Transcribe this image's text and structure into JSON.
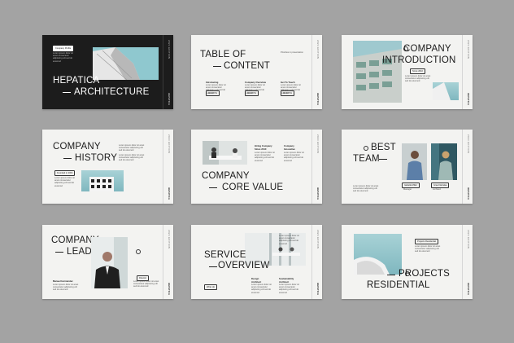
{
  "slides": {
    "s1": {
      "badge": "Company Profile",
      "title1": "HEPATICA",
      "title2": "ARCHITECTURE",
      "side_top": "2023 EDITION",
      "side_bot": "HEPATICA"
    },
    "s2": {
      "title1": "TABLE OF",
      "title2": "CONTENT",
      "c1": "Introducing",
      "c2": "Company Overview",
      "c3": "Get To Touch",
      "c3b": "Priorities in presentation",
      "n1": "00-00 PH",
      "n2": "00-00 PH",
      "n3": "00-00 PH",
      "side_top": "2023 EDITION",
      "side_bot": "HEPATICA"
    },
    "s3": {
      "title1": "COMPANY",
      "title2": "INTRODUCTION",
      "badge": "Since 2010",
      "side_top": "2023 EDITION",
      "side_bot": "HEPATICA"
    },
    "s4": {
      "title1": "COMPANY",
      "title2": "HISTORY",
      "badge": "Founded in 2004",
      "side_top": "2023 EDITION",
      "side_bot": "HEPATICA"
    },
    "s5": {
      "title1": "COMPANY",
      "title2": "CORE VALUE",
      "h1": "Hiring Company Since 2010",
      "h2": "Company Innovative",
      "side_top": "2023 EDITION",
      "side_bot": "HEPATICA"
    },
    "s6": {
      "title1": "BEST",
      "title2": "TEAM",
      "n1": "Isabella Miller",
      "r1": "Manager",
      "n2": "Grea Narralaa",
      "r2": "Architect",
      "side_top": "2023 EDITION",
      "side_bot": "HEPATICA"
    },
    "s7": {
      "title1": "COMPANY",
      "title2": "LEADER",
      "badge": "Director",
      "name": "Manuel Hernandez",
      "side_top": "2023 EDITION",
      "side_bot": "HEPATICA"
    },
    "s8": {
      "title1": "SERVICE",
      "title2": "OVERVIEW",
      "h1": "Design Architect",
      "h2": "Sustainability Architect",
      "btn": "Write Up",
      "side_top": "2023 EDITION",
      "side_bot": "HEPATICA"
    },
    "s9": {
      "title1": "PROJECTS",
      "title2": "RESIDENTIAL",
      "badge": "Projects Residential",
      "side_top": "2023 EDITION",
      "side_bot": "HEPATICA"
    }
  },
  "lorem": "Lorem ipsum dolor sit amet consectetur adipiscing elit sed do eiusmod"
}
